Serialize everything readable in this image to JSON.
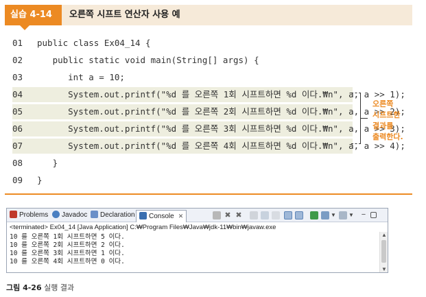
{
  "header": {
    "badge": "실습 4-14",
    "title": "오른쪽 시프트 연산자 사용 예"
  },
  "code": {
    "lines": [
      {
        "num": "01",
        "text": "public class Ex04_14 {"
      },
      {
        "num": "02",
        "text": "   public static void main(String[] args) {"
      },
      {
        "num": "03",
        "text": "      int a = 10;"
      },
      {
        "num": "04",
        "text": "      System.out.printf(\"%d 를 오른쪽 1회 시프트하면 %d 이다.₩n\", a, a >> 1);"
      },
      {
        "num": "05",
        "text": "      System.out.printf(\"%d 를 오른쪽 2회 시프트하면 %d 이다.₩n\", a, a >> 2);"
      },
      {
        "num": "06",
        "text": "      System.out.printf(\"%d 를 오른쪽 3회 시프트하면 %d 이다.₩n\", a, a >> 3);"
      },
      {
        "num": "07",
        "text": "      System.out.printf(\"%d 를 오른쪽 4회 시프트하면 %d 이다.₩n\", a, a >> 4);"
      },
      {
        "num": "08",
        "text": "   }"
      },
      {
        "num": "09",
        "text": "}"
      }
    ],
    "annotation": [
      "오른쪽",
      "시프트한",
      "결과를",
      "출력한다."
    ]
  },
  "console": {
    "tabs": [
      {
        "label": "Problems",
        "icon": "problems-icon",
        "color": "#c0392b"
      },
      {
        "label": "Javadoc",
        "icon": "javadoc-icon",
        "color": "#4a7fc1"
      },
      {
        "label": "Declaration",
        "icon": "declaration-icon",
        "color": "#6a8fc8"
      },
      {
        "label": "Console",
        "icon": "console-icon",
        "color": "#3a6fb0",
        "active": true
      }
    ],
    "status": "<terminated> Ex04_14 [Java Application] C:₩Program Files₩Java₩jdk-11₩bin₩javaw.exe",
    "output": [
      "10 를 오른쪽 1회 시프트하면 5 이다.",
      "10 를 오른쪽 2회 시프트하면 2 이다.",
      "10 를 오른쪽 3회 시프트하면 1 이다.",
      "10 를 오른쪽 4회 시프트하면 0 이다."
    ]
  },
  "caption": {
    "label": "그림 4-26",
    "text": "실행 결과"
  },
  "colors": {
    "accent": "#ec8a23",
    "header_bg": "#f6ead9",
    "highlight": "#eeeedf"
  }
}
